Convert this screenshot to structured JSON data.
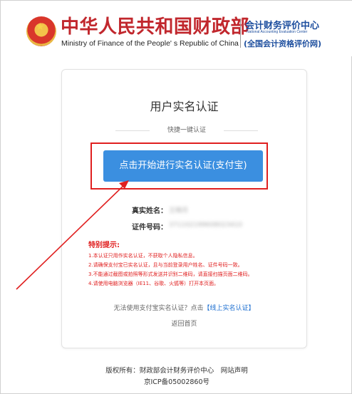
{
  "header": {
    "ministry_cn": "中华人民共和国财政部",
    "ministry_en": "Ministry of Finance of the People' s Republic of China",
    "center_cn": "会计财务评价中心",
    "center_en": "National Accounting Evaluation Center",
    "center_sub": "(全国会计资格评价网)"
  },
  "card": {
    "title": "用户实名认证",
    "quick_label": "快捷一键认证",
    "main_button": "点击开始进行实名认证(支付宝)",
    "name_label": "真实姓名：",
    "name_value": "王晓月",
    "id_label": "证件号码：",
    "id_value": "371102199608023410",
    "tips_title": "特别提示:",
    "tips": [
      "1.本认证只用作实名认证，不获取个人隐私信息。",
      "2.请确保支付宝已实名认证，且与当前登录用户姓名、证件号码一致。",
      "3.不能通过截图或拍照等形式发送并识别二维码，请直接扫描页面二维码。",
      "4.请使用电脑浏览器（IE11、谷歌、火狐等）打开本页面。"
    ],
    "alt_text": "无法使用支付宝实名认证？点击",
    "alt_link": "【线上实名认证】",
    "back_link": "返回首页"
  },
  "footer": {
    "copyright": "版权所有：财政部会计财务评价中心　网站声明",
    "icp": "京ICP备05002860号"
  },
  "colors": {
    "brand_red": "#c1272d",
    "brand_blue": "#1d4e9e",
    "button_blue": "#3b8fe0",
    "highlight_red": "#e02020"
  }
}
